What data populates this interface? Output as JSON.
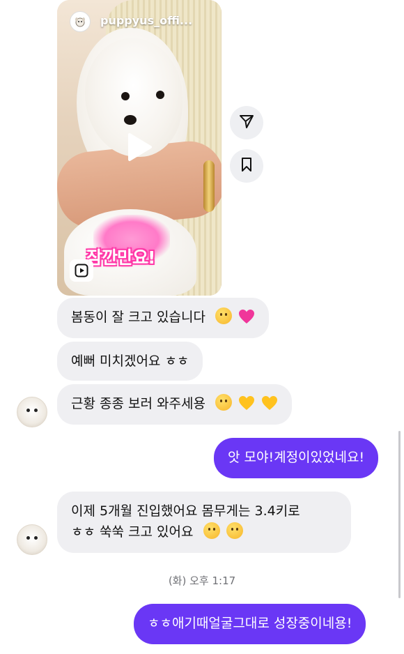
{
  "reel_share": {
    "account_name": "puppyus_offi...",
    "video_caption": "잠깐만요!",
    "avatar_icon": "dog-logo-icon",
    "play_icon": "play-icon",
    "reels_icon": "reels-icon"
  },
  "side_actions": [
    {
      "icon": "send-icon"
    },
    {
      "icon": "bookmark-icon"
    }
  ],
  "messages": [
    {
      "id": "m1",
      "direction": "incoming",
      "text": "봄동이 잘 크고 있습니다",
      "emojis": [
        "kissing-face",
        "pink-heart"
      ]
    },
    {
      "id": "m2",
      "direction": "incoming",
      "text": "예뻐 미치겠어요 ㅎㅎ",
      "emojis": []
    },
    {
      "id": "m3",
      "direction": "incoming",
      "text": "근황 종종 보러 와주세용",
      "emojis": [
        "tongue-face",
        "yellow-heart",
        "yellow-heart"
      ]
    },
    {
      "id": "m4",
      "direction": "outgoing",
      "text": "앗 모야!계정이있었네요!",
      "emojis": []
    },
    {
      "id": "m5",
      "direction": "incoming",
      "line1": "이제 5개월 진입했어요 몸무게는 3.4키로",
      "line2": "ㅎㅎ 쑥쑥 크고 있어요",
      "emojis": [
        "kissing-closed-eyes-face",
        "kissing-closed-eyes-face"
      ]
    },
    {
      "id": "m6",
      "direction": "outgoing",
      "text": "ㅎㅎ애기때얼굴그대로 성장중이네용!",
      "emojis": []
    }
  ],
  "timestamp": "(화) 오후 1:17",
  "colors": {
    "incoming_bubble": "#efeff2",
    "outgoing_bubble": "#6a37f5",
    "outgoing_text": "#ffffff",
    "timestamp_text": "#6f7075"
  }
}
